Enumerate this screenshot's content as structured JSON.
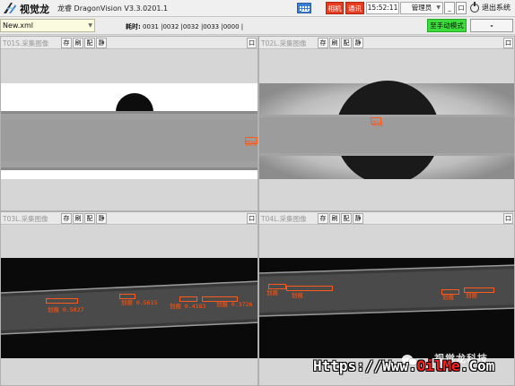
{
  "app": {
    "logo_text": "视觉龙",
    "title": "龙睿 DragonVision V3.3.0201.1"
  },
  "topbar": {
    "camera_label": "相机",
    "comm_label": "通讯",
    "clock": "15:52:11",
    "user": "管理员",
    "minimize_label": "_",
    "maximize_label": "口",
    "exit_label": "退出系统"
  },
  "toolbar": {
    "file_value": "New.xml",
    "timing_label": "耗时:",
    "timings": [
      "0031",
      "|0032",
      "|0032",
      "|0033",
      "|0000",
      "|"
    ],
    "manual_mode_label": "至手动模式",
    "dash_label": "-"
  },
  "panels": [
    {
      "name": "T01S.采集图像",
      "buttons": [
        "存",
        "刷",
        "配",
        "静"
      ],
      "max_label": "口",
      "annotations": [
        {
          "text": "首线"
        }
      ]
    },
    {
      "name": "T02L.采集图像",
      "buttons": [
        "存",
        "刷",
        "配",
        "静"
      ],
      "max_label": "口",
      "annotations": [
        {
          "text": "首线"
        }
      ]
    },
    {
      "name": "T03L.采集图像",
      "buttons": [
        "存",
        "刷",
        "配",
        "静"
      ],
      "max_label": "口",
      "annotations": [
        {
          "text": "划痕 0.5027"
        },
        {
          "text": "划痕 0.5615"
        },
        {
          "text": "划痕 0.4183"
        },
        {
          "text": "划痕 0.3726"
        }
      ]
    },
    {
      "name": "T04L.采集图像",
      "buttons": [
        "存",
        "刷",
        "配",
        "静"
      ],
      "max_label": "口",
      "annotations": [
        {
          "text": "划痕"
        },
        {
          "text": "划痕"
        },
        {
          "text": "划痕"
        },
        {
          "text": "划痕"
        }
      ]
    }
  ],
  "watermark": {
    "text": "视觉龙科技",
    "url_prefix": "Https://Www.",
    "url_brand": "OilMe",
    "url_suffix": ".Com"
  },
  "colors": {
    "accent_red": "#e83a1e",
    "accent_green": "#3ddc3d",
    "annotation": "#ff5a1a",
    "keyboard_icon": "#3a7fd5"
  },
  "icons": {
    "logo": "dragon-logo-icon",
    "keyboard": "keyboard-icon",
    "exit": "power-icon",
    "wechat": "wechat-icon"
  }
}
